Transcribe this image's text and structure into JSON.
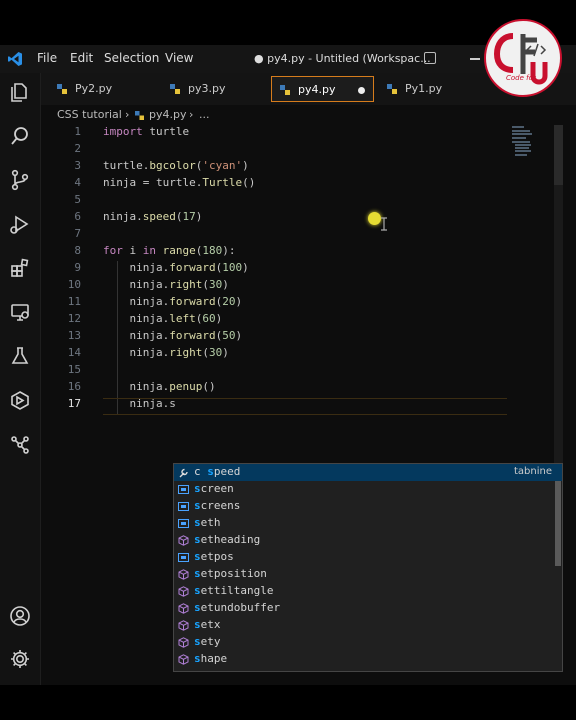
{
  "menu": [
    "File",
    "Edit",
    "Selection",
    "View"
  ],
  "window_title": "● py4.py - Untitled (Workspac...",
  "tabs": [
    {
      "label": "Py2.py",
      "active": false
    },
    {
      "label": "py3.py",
      "active": false
    },
    {
      "label": "py4.py",
      "active": true,
      "modified": true
    },
    {
      "label": "Py1.py",
      "active": false
    }
  ],
  "breadcrumb": {
    "folder": "CSS tutorial",
    "file": "py4.py",
    "trail": "..."
  },
  "editor": {
    "lines": [
      {
        "n": "1",
        "code": "import turtle"
      },
      {
        "n": "2",
        "code": ""
      },
      {
        "n": "3",
        "code": "turtle.bgcolor('cyan')"
      },
      {
        "n": "4",
        "code": "ninja = turtle.Turtle()"
      },
      {
        "n": "5",
        "code": ""
      },
      {
        "n": "6",
        "code": "ninja.speed(17)"
      },
      {
        "n": "7",
        "code": ""
      },
      {
        "n": "8",
        "code": "for i in range(180):"
      },
      {
        "n": "9",
        "code": "    ninja.forward(100)"
      },
      {
        "n": "10",
        "code": "    ninja.right(30)"
      },
      {
        "n": "11",
        "code": "    ninja.forward(20)"
      },
      {
        "n": "12",
        "code": "    ninja.left(60)"
      },
      {
        "n": "13",
        "code": "    ninja.forward(50)"
      },
      {
        "n": "14",
        "code": "    ninja.right(30)"
      },
      {
        "n": "15",
        "code": ""
      },
      {
        "n": "16",
        "code": "    ninja.penup()"
      },
      {
        "n": "17",
        "code": "    ninja.s"
      }
    ],
    "current_line": "17"
  },
  "suggestions": [
    {
      "label": "speed",
      "prefix": "c",
      "icon": "wrench-icon",
      "detail": "tabnine",
      "selected": true
    },
    {
      "label": "screen",
      "icon": "field-icon"
    },
    {
      "label": "screens",
      "icon": "field-icon"
    },
    {
      "label": "seth",
      "icon": "field-icon"
    },
    {
      "label": "setheading",
      "icon": "method-cube-icon"
    },
    {
      "label": "setpos",
      "icon": "field-icon"
    },
    {
      "label": "setposition",
      "icon": "method-cube-icon"
    },
    {
      "label": "settiltangle",
      "icon": "method-cube-icon"
    },
    {
      "label": "setundobuffer",
      "icon": "method-cube-icon"
    },
    {
      "label": "setx",
      "icon": "method-cube-icon"
    },
    {
      "label": "sety",
      "icon": "method-cube-icon"
    },
    {
      "label": "shape",
      "icon": "method-cube-icon"
    }
  ],
  "activity_icons": [
    "explorer-icon",
    "search-icon",
    "source-control-icon",
    "run-debug-icon",
    "extensions-icon",
    "remote-explorer-icon",
    "testing-icon",
    "docker-icon",
    "git-graph-icon",
    "account-icon",
    "settings-gear-icon"
  ],
  "watermark": {
    "text": "Code for",
    "letters": "CFU"
  },
  "colors": {
    "keyword": "#c586c0",
    "function": "#dcdcaa",
    "number": "#b5cea8",
    "string": "#ce9178",
    "accent_tab": "#d67c1c",
    "suggest_highlight": "#18a3ff"
  }
}
